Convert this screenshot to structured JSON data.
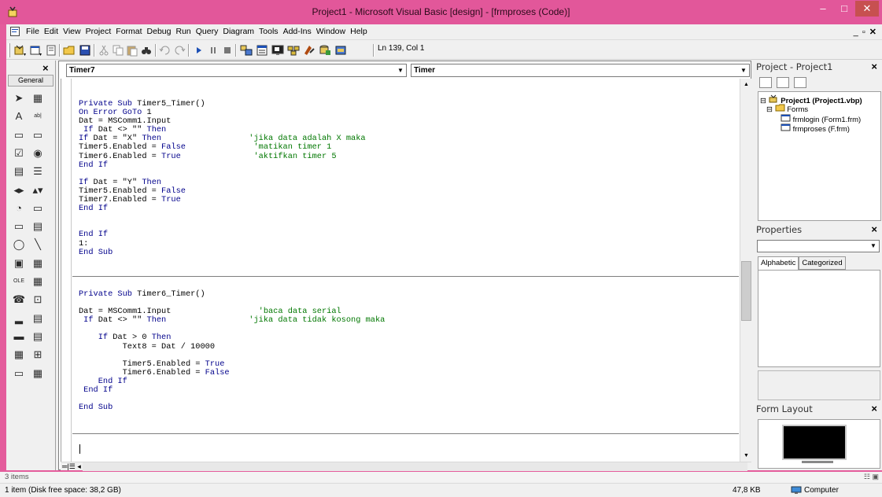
{
  "window": {
    "title": "Project1 - Microsoft Visual Basic [design] - [frmproses (Code)]",
    "titlebar_color": "#e2579a",
    "minimize_glyph": "–",
    "maximize_glyph": "□",
    "close_glyph": "✕"
  },
  "menubar": {
    "items": [
      "File",
      "Edit",
      "View",
      "Project",
      "Format",
      "Debug",
      "Run",
      "Query",
      "Diagram",
      "Tools",
      "Add-Ins",
      "Window",
      "Help"
    ],
    "mdi_controls": "_ ̲̲̲▫ ×"
  },
  "toolbar": {
    "icons": [
      "add-project-icon",
      "add-form-icon",
      "menu-editor-icon",
      "open-project-icon",
      "save-project-icon",
      "cut-icon",
      "copy-icon",
      "paste-icon",
      "find-icon",
      "undo-icon",
      "redo-icon",
      "start-icon",
      "break-icon",
      "end-icon",
      "project-explorer-icon",
      "properties-window-icon",
      "form-layout-icon",
      "object-browser-icon",
      "toolbox-icon",
      "data-view-icon",
      "component-manager-icon"
    ],
    "position": "Ln 139, Col 1"
  },
  "toolbox": {
    "close": "×",
    "tab_label": "General",
    "tools": [
      "pointer-icon",
      "picturebox-icon",
      "label-icon",
      "textbox-icon",
      "frame-icon",
      "commandbutton-icon",
      "checkbox-icon",
      "optionbutton-icon",
      "combobox-icon",
      "listbox-icon",
      "hscrollbar-icon",
      "vscrollbar-icon",
      "timer-icon",
      "drivelistbox-icon",
      "dirlistbox-icon",
      "filelistbox-icon",
      "shape-icon",
      "line-icon",
      "image-icon",
      "data-icon",
      "ole-icon",
      "adodc-icon",
      "mscomm-icon",
      "commondialog-icon",
      "statusbar-icon",
      "listview-icon",
      "toolbar-icon",
      "treeview-icon",
      "imagelist-icon",
      "winsock-icon",
      "progressbar-icon",
      "datagrid-icon"
    ]
  },
  "code_window": {
    "object_combo": "Timer7",
    "procedure_combo": "Timer",
    "lines_block1": [
      [
        "",
        [
          [
            "kw",
            "Private Sub "
          ],
          [
            "",
            "Timer5_Timer()"
          ]
        ]
      ],
      [
        "",
        [
          [
            "kw",
            "On Error GoTo "
          ],
          [
            "",
            "1"
          ]
        ]
      ],
      [
        "",
        [
          [
            "",
            "Dat = MSComm1.Input"
          ]
        ]
      ],
      [
        "",
        [
          [
            "kw",
            " If "
          ],
          [
            "",
            "Dat <> \"\" "
          ],
          [
            "kw",
            "Then"
          ]
        ]
      ],
      [
        "",
        [
          [
            "kw",
            "If "
          ],
          [
            "",
            "Dat = \"X\" "
          ],
          [
            "kw",
            "Then"
          ],
          [
            "",
            "                  "
          ],
          [
            "cm",
            "'jika data adalah X maka"
          ]
        ]
      ],
      [
        "",
        [
          [
            "",
            "Timer5.Enabled = "
          ],
          [
            "kw",
            "False"
          ],
          [
            "",
            "              "
          ],
          [
            "cm",
            "'matikan timer 1"
          ]
        ]
      ],
      [
        "",
        [
          [
            "",
            "Timer6.Enabled = "
          ],
          [
            "kw",
            "True"
          ],
          [
            "",
            "               "
          ],
          [
            "cm",
            "'aktifkan timer 5"
          ]
        ]
      ],
      [
        "",
        [
          [
            "kw",
            "End If"
          ]
        ]
      ],
      [
        "",
        [
          [
            "",
            ""
          ]
        ]
      ],
      [
        "",
        [
          [
            "kw",
            "If "
          ],
          [
            "",
            "Dat = \"Y\" "
          ],
          [
            "kw",
            "Then"
          ]
        ]
      ],
      [
        "",
        [
          [
            "",
            "Timer5.Enabled = "
          ],
          [
            "kw",
            "False"
          ]
        ]
      ],
      [
        "",
        [
          [
            "",
            "Timer7.Enabled = "
          ],
          [
            "kw",
            "True"
          ]
        ]
      ],
      [
        "",
        [
          [
            "kw",
            "End If"
          ]
        ]
      ],
      [
        "",
        [
          [
            "",
            ""
          ]
        ]
      ],
      [
        "",
        [
          [
            "",
            ""
          ]
        ]
      ],
      [
        "",
        [
          [
            "kw",
            "End If"
          ]
        ]
      ],
      [
        "",
        [
          [
            "",
            "1:"
          ]
        ]
      ],
      [
        "",
        [
          [
            "kw",
            "End Sub"
          ]
        ]
      ]
    ],
    "lines_block2": [
      [
        "",
        [
          [
            "kw",
            "Private Sub "
          ],
          [
            "",
            "Timer6_Timer()"
          ]
        ]
      ],
      [
        "",
        [
          [
            "",
            ""
          ]
        ]
      ],
      [
        "",
        [
          [
            "",
            "Dat = MSComm1.Input"
          ],
          [
            "",
            "                  "
          ],
          [
            "cm",
            "'baca data serial"
          ]
        ]
      ],
      [
        "",
        [
          [
            "kw",
            " If "
          ],
          [
            "",
            "Dat <> \"\" "
          ],
          [
            "kw",
            "Then"
          ],
          [
            "",
            "                 "
          ],
          [
            "cm",
            "'jika data tidak kosong maka"
          ]
        ]
      ],
      [
        "",
        [
          [
            "",
            ""
          ]
        ]
      ],
      [
        "",
        [
          [
            "kw",
            "    If "
          ],
          [
            "",
            "Dat > 0 "
          ],
          [
            "kw",
            "Then"
          ]
        ]
      ],
      [
        "",
        [
          [
            "",
            "         Text8 = Dat / 10000"
          ]
        ]
      ],
      [
        "",
        [
          [
            "",
            ""
          ]
        ]
      ],
      [
        "",
        [
          [
            "",
            "         Timer5.Enabled = "
          ],
          [
            "kw",
            "True"
          ]
        ]
      ],
      [
        "",
        [
          [
            "",
            "         Timer6.Enabled = "
          ],
          [
            "kw",
            "False"
          ]
        ]
      ],
      [
        "",
        [
          [
            "kw",
            "    End If"
          ]
        ]
      ],
      [
        "",
        [
          [
            "kw",
            " End If"
          ]
        ]
      ],
      [
        "",
        [
          [
            "",
            ""
          ]
        ]
      ],
      [
        "",
        [
          [
            "kw",
            "End Sub"
          ]
        ]
      ]
    ]
  },
  "project_panel": {
    "title": "Project - Project1",
    "close": "×",
    "project_node": "Project1 (Project1.vbp)",
    "forms_node": "Forms",
    "form_items": [
      "frmlogin (Form1.frm)",
      "frmproses (F.frm)"
    ]
  },
  "properties_panel": {
    "title": "Properties",
    "close": "×",
    "tabs": [
      "Alphabetic",
      "Categorized"
    ]
  },
  "form_layout_panel": {
    "title": "Form Layout",
    "close": "×"
  },
  "explorer_status": {
    "items_count": "3 items",
    "selection": "1 item (Disk free space: 38,2 GB)",
    "size": "47,8 KB",
    "location": "Computer"
  }
}
